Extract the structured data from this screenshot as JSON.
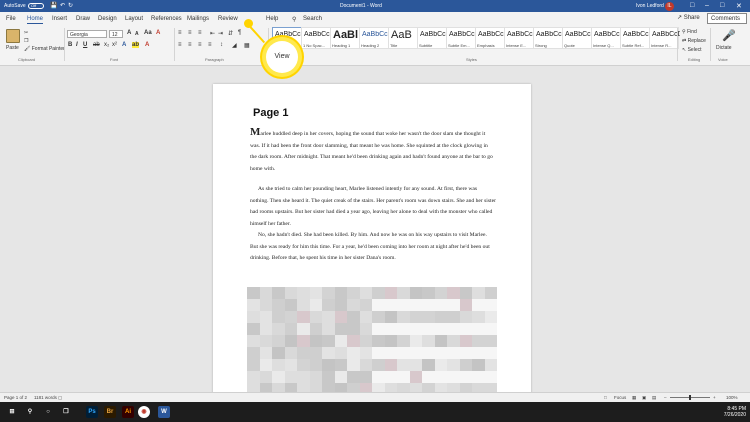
{
  "titlebar": {
    "autosave_label": "AutoSave",
    "autosave_state": "Off",
    "doc_title": "Document1 - Word",
    "user_name": "Ivon Ledford",
    "user_initial": "IL"
  },
  "menu": {
    "tabs": [
      "File",
      "Home",
      "Insert",
      "Draw",
      "Design",
      "Layout",
      "References",
      "Mailings",
      "Review",
      "View",
      "Help"
    ],
    "active_tab": "Home",
    "search_label": "Search",
    "share_label": "Share",
    "comments_label": "Comments"
  },
  "ribbon": {
    "clipboard": {
      "paste_label": "Paste",
      "cut_label": "Cut",
      "copy_label": "Copy",
      "format_painter_label": "Format Painter",
      "group_label": "Clipboard"
    },
    "font": {
      "family": "Georgia",
      "size": "12",
      "bold": "B",
      "italic": "I",
      "underline": "U",
      "group_label": "Font"
    },
    "paragraph": {
      "group_label": "Paragraph"
    },
    "styles": {
      "items": [
        {
          "sample": "AaBbCcC",
          "name": "Normal"
        },
        {
          "sample": "AaBbCcC",
          "name": "1 No Spac..."
        },
        {
          "sample": "AaBl",
          "name": "Heading 1"
        },
        {
          "sample": "AaBbCcC",
          "name": "Heading 2"
        },
        {
          "sample": "AaB",
          "name": "Title"
        },
        {
          "sample": "AaBbCcC",
          "name": "Subtitle"
        },
        {
          "sample": "AaBbCcDd",
          "name": "Subtle Em..."
        },
        {
          "sample": "AaBbCcDd",
          "name": "Emphasis"
        },
        {
          "sample": "AaBbCcDd",
          "name": "Intense E..."
        },
        {
          "sample": "AaBbCcDd",
          "name": "Strong"
        },
        {
          "sample": "AaBbCcDd",
          "name": "Quote"
        },
        {
          "sample": "AaBbCcDd",
          "name": "Intense Q..."
        },
        {
          "sample": "AaBbCcDd",
          "name": "Subtle Ref..."
        },
        {
          "sample": "AaBbCcDd",
          "name": "Intense R..."
        }
      ],
      "group_label": "Styles"
    },
    "editing": {
      "find_label": "Find",
      "replace_label": "Replace",
      "select_label": "Select",
      "group_label": "Editing"
    },
    "voice": {
      "dictate_label": "Dictate",
      "group_label": "Voice"
    }
  },
  "callout": {
    "label": "View"
  },
  "document": {
    "heading": "Page 1",
    "paragraphs": [
      {
        "dropcap": "M",
        "text": "arlee huddled deep in her covers, hoping the sound that woke her wasn't the door slam she thought it was. If it had been the front door slamming, that meant he was home. She squinted at the clock glowing in the dark room. After midnight. That meant he'd been drinking again and hadn't found anyone at the bar to go home with."
      },
      {
        "dropcap": "",
        "text": "As she tried to calm her pounding heart, Marlee listened intently for any sound. At first, there was nothing. Then she heard it. The quiet creak of the stairs. Her parent's room was down stairs. She and her sister had rooms upstairs. But her sister had died a year ago, leaving her alone to deal with the monster who called himself her father."
      },
      {
        "dropcap": "",
        "text": "No, she hadn't died. She had been killed. By him. And now he was on his way upstairs to visit Marlee. But she was ready for him this time. For a year, he'd been coming into her room at night after he'd been out drinking. Before that, he spent his time in her sister Dana's room."
      }
    ]
  },
  "status": {
    "page": "Page 1 of 2",
    "words": "1181 words",
    "focus_label": "Focus",
    "zoom": "100%"
  },
  "taskbar": {
    "time": "8:45 PM",
    "date": "7/26/2020",
    "apps": [
      "Ps",
      "Br",
      "Ai",
      "Word"
    ]
  },
  "colors": {
    "accent": "#2b579a",
    "highlight": "#ffd400"
  }
}
